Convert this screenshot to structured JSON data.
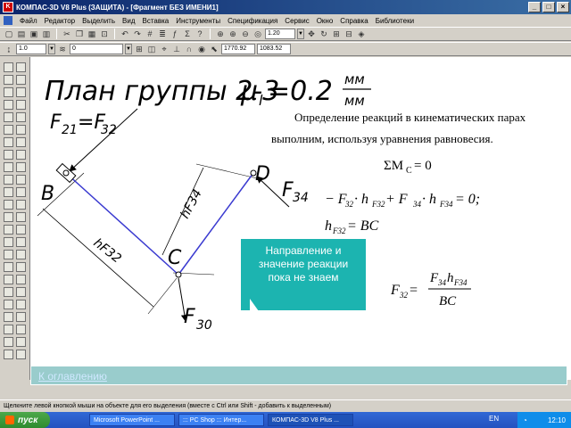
{
  "window": {
    "title": "КОМПАС-3D V8 Plus (ЗАЩИТА) - [Фрагмент БЕЗ ИМЕНИ1]",
    "buttons": [
      "_",
      "□",
      "×"
    ]
  },
  "menu": {
    "items": [
      "Файл",
      "Редактор",
      "Выделить",
      "Вид",
      "Вставка",
      "Инструменты",
      "Спецификация",
      "Сервис",
      "Окно",
      "Справка",
      "Библиотеки"
    ]
  },
  "toolbar2": {
    "line_width": "1.0",
    "layer": "0",
    "zoom": "1.20",
    "coord_x": "1770.92",
    "coord_y": "1083.52"
  },
  "drawing": {
    "title_main": "План группы 2-3",
    "title_mu": "μ",
    "title_sub": "l",
    "title_eq": "=0.2",
    "title_frac_top": "мм",
    "title_frac_bot": "мм",
    "label_F21": "F",
    "label_F21_sub": "21",
    "label_eq": "=F",
    "label_F32_sub": "32",
    "label_B": "B",
    "label_C": "C",
    "label_D": "D",
    "label_F34": "F",
    "label_F34_sub": "34",
    "label_F30": "F",
    "label_F30_sub": "30",
    "label_h34": "hF34",
    "label_h32": "hF32",
    "text_line1": "Определение реакций в кинематических парах",
    "text_line2": "выполним,  используя уравнения равновесия.",
    "eq_sum": "ΣM",
    "eq_sum_sub": "C",
    "eq_sum_rhs": "= 0",
    "eq_line1": "− F",
    "eq_l1_s1": "32",
    "eq_l1_h1": " · h",
    "eq_l1_s2": "F32",
    "eq_l1_p": " + F",
    "eq_l1_s3": "34",
    "eq_l1_h2": " · h",
    "eq_l1_s4": "F34",
    "eq_l1_end": " = 0;",
    "eq_h": "h",
    "eq_h_sub": "F32",
    "eq_h_rhs": " = BC",
    "eq_F": "F",
    "eq_F_sub": "32",
    "eq_F_eq": " = ",
    "eq_num_a": "F",
    "eq_num_a_sub": "34",
    "eq_num_b": "h",
    "eq_num_b_sub": "F34",
    "eq_den": "BC"
  },
  "tooltip": {
    "text": "Направление и значение реакции пока не знаем"
  },
  "nav": {
    "link": "К оглавлению"
  },
  "status": {
    "text": "Щелкните левой кнопкой мыши на объекте для его выделения (вместе с Ctrl или Shift - добавить к выделенным)"
  },
  "taskbar": {
    "start": "пуск",
    "tasks": [
      "Microsoft PowerPoint ...",
      "::: PC Shop ::: Интер...",
      "КОМПАС-3D V8 Plus ..."
    ],
    "lang": "EN",
    "clock": "12:10"
  },
  "colors": {
    "mechanism": "#3a3ad0",
    "tooltip_bg": "#1cb4b0",
    "title_bar": "#0a246a"
  }
}
